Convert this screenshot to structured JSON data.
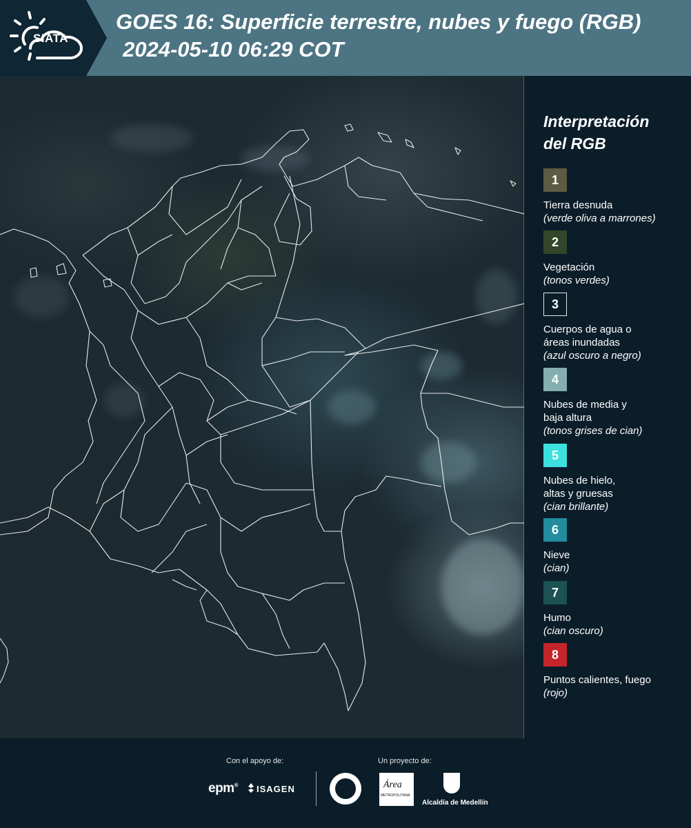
{
  "header": {
    "logo_text": "SIATA",
    "title_line1": "GOES 16: Superficie terrestre, nubes y fuego (RGB)",
    "title_line2": "2024-05-10 06:29 COT"
  },
  "legend": {
    "title_line1": "Interpretación",
    "title_line2": "del RGB",
    "items": [
      {
        "num": "1",
        "name": "Tierra desnuda",
        "desc": "(verde oliva a marrones)",
        "color": "#5d5b43"
      },
      {
        "num": "2",
        "name": "Vegetación",
        "desc": "(tonos verdes)",
        "color": "#33462a"
      },
      {
        "num": "3",
        "name": "Cuerpos de agua o áreas inundadas",
        "desc": "(azul oscuro a negro)",
        "color": "#0b1d29"
      },
      {
        "num": "4",
        "name": "Nubes de media y baja altura",
        "desc": "(tonos grises de cian)",
        "color": "#84aeb0"
      },
      {
        "num": "5",
        "name": "Nubes de hielo, altas y gruesas",
        "desc": "(cian brillante)",
        "color": "#3ce1df"
      },
      {
        "num": "6",
        "name": "Nieve",
        "desc": "(cian)",
        "color": "#238c9e"
      },
      {
        "num": "7",
        "name": "Humo",
        "desc": "(cian oscuro)",
        "color": "#1c5155"
      },
      {
        "num": "8",
        "name": "Puntos calientes, fuego",
        "desc": "(rojo)",
        "color": "#c3252a"
      }
    ]
  },
  "footer": {
    "support_label": "Con el apoyo de:",
    "project_label": "Un proyecto de:",
    "epm": "epm",
    "isagen": "ISAGEN",
    "area_logo": "Área",
    "area_sub": "METROPOLITANA",
    "alcaldia": "Alcaldía de Medellín"
  }
}
